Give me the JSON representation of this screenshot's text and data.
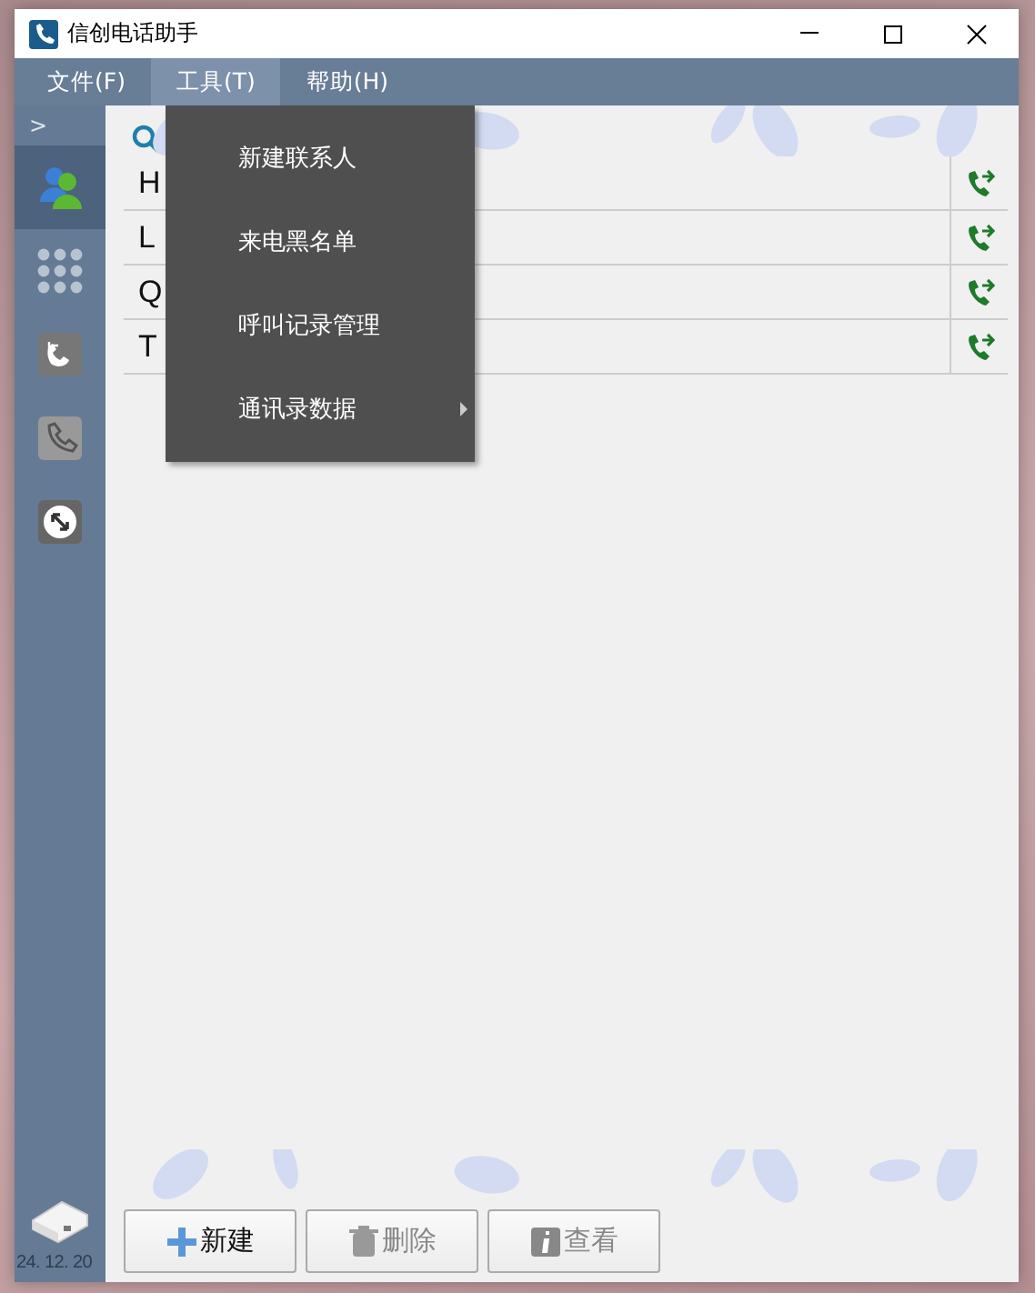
{
  "window": {
    "title": "信创电话助手"
  },
  "menu_bar": [
    {
      "label": "文件(F)",
      "selected": false
    },
    {
      "label": "工具(T)",
      "selected": true
    },
    {
      "label": "帮助(H)",
      "selected": false
    }
  ],
  "sidebar": {
    "expand_glyph": ">",
    "items": [
      {
        "kind": "contacts",
        "selected": true
      },
      {
        "kind": "dialpad",
        "selected": false
      },
      {
        "kind": "call-log",
        "selected": false
      },
      {
        "kind": "phone",
        "selected": false
      },
      {
        "kind": "sync",
        "selected": false
      }
    ],
    "date": "24. 12. 20"
  },
  "contacts": [
    {
      "name": "H"
    },
    {
      "name": "L"
    },
    {
      "name": "Q"
    },
    {
      "name": "T"
    }
  ],
  "dropdown": [
    {
      "label": "新建联系人",
      "has_submenu": false
    },
    {
      "label": "来电黑名单",
      "has_submenu": false
    },
    {
      "label": "呼叫记录管理",
      "has_submenu": false
    },
    {
      "label": "通讯录数据",
      "has_submenu": true
    }
  ],
  "buttons": [
    {
      "kind": "new",
      "label": "新建",
      "disabled": false
    },
    {
      "kind": "delete",
      "label": "删除",
      "disabled": true
    },
    {
      "kind": "view",
      "label": "查看",
      "disabled": true
    }
  ]
}
